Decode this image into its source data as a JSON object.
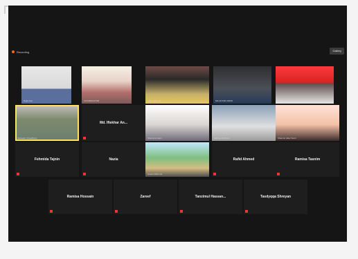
{
  "recording": {
    "label": "Recording"
  },
  "view_button": {
    "label": "Gallery"
  },
  "participants": {
    "row1": [
      {
        "label": "Rajib Das"
      },
      {
        "label": "COORDINATOR"
      },
      {
        "label": "Sajib Mahmud"
      },
      {
        "label": "MD AFTAB UDDIN"
      },
      {
        "label": "Tamanna"
      }
    ],
    "row2": [
      {
        "label": "Mobassir Chowdhury"
      },
      {
        "label": "Md. Iftekhar An..."
      },
      {
        "label": "Shamima Islam"
      },
      {
        "label": "Sabrina Rahman"
      },
      {
        "label": "Sharmin Akter Sumi"
      }
    ],
    "row3": [
      {
        "label": "Fehmida Tajnin"
      },
      {
        "label": "Nazia"
      },
      {
        "label": "Hasan Mahmud"
      },
      {
        "label": "Rafid Ahmed"
      },
      {
        "label": "Ramisa Tasnim"
      }
    ],
    "row4": [
      {
        "label": "Ramisa Hossain"
      },
      {
        "label": "Zareef"
      },
      {
        "label": "Tanzimul Hassan..."
      },
      {
        "label": "Tasdyqqa Shreyan"
      }
    ]
  }
}
